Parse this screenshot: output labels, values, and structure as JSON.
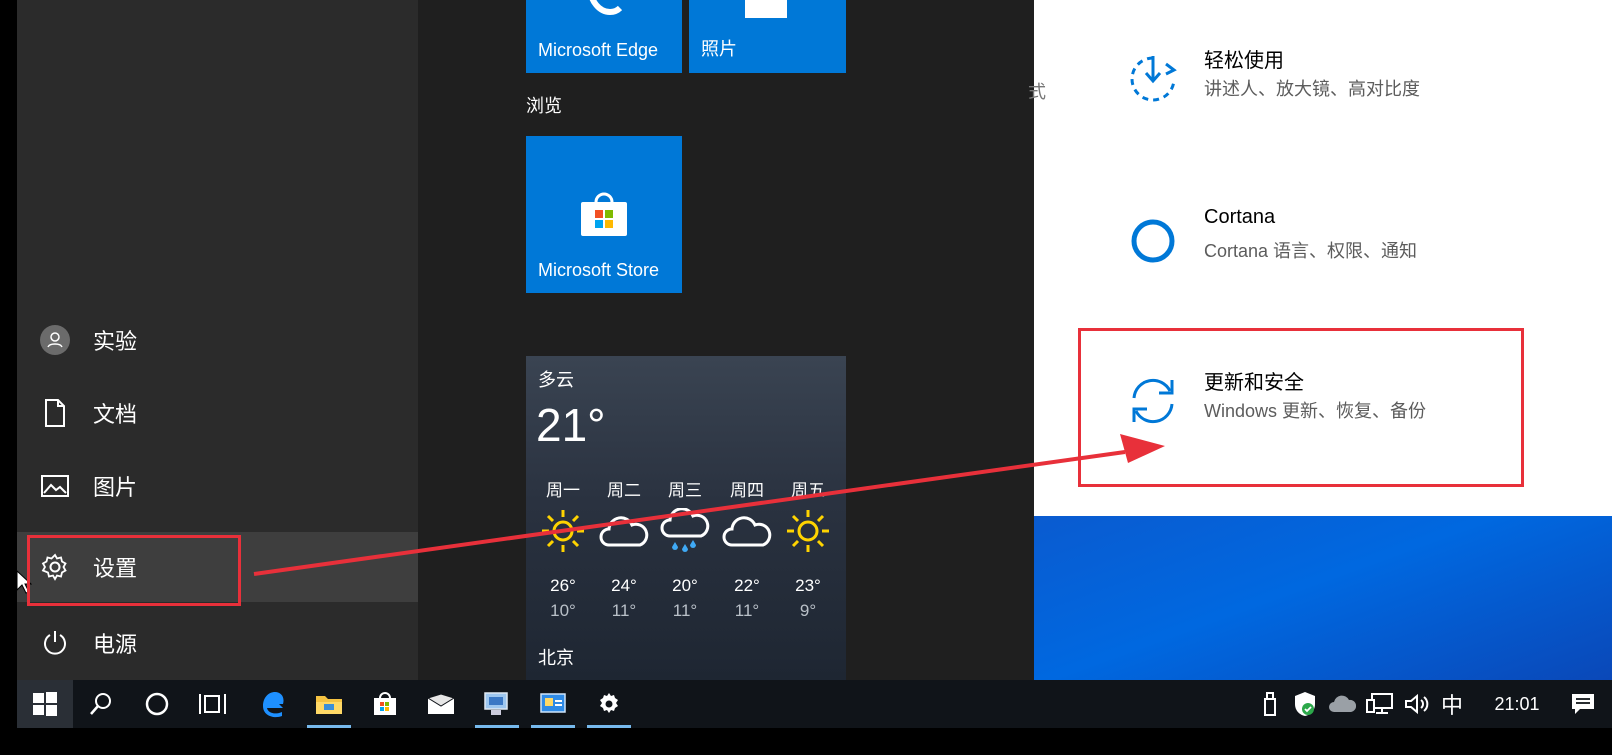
{
  "start_menu": {
    "user_label": "实验",
    "documents_label": "文档",
    "pictures_label": "图片",
    "settings_label": "设置",
    "power_label": "电源"
  },
  "tiles": {
    "edge_label": "Microsoft Edge",
    "photos_label": "照片",
    "browse_group_label": "浏览",
    "store_label": "Microsoft Store"
  },
  "weather": {
    "condition": "多云",
    "temperature": "21°",
    "city": "北京",
    "forecast": [
      {
        "day": "周一",
        "icon": "sunny-icon",
        "high": "26°",
        "low": "10°"
      },
      {
        "day": "周二",
        "icon": "cloudy-icon",
        "high": "24°",
        "low": "11°"
      },
      {
        "day": "周三",
        "icon": "rain-icon",
        "high": "20°",
        "low": "11°"
      },
      {
        "day": "周四",
        "icon": "cloudy-icon",
        "high": "22°",
        "low": "11°"
      },
      {
        "day": "周五",
        "icon": "sunny-icon",
        "high": "23°",
        "low": "9°"
      }
    ]
  },
  "settings_window": {
    "partial_text": "式",
    "items": [
      {
        "title": "轻松使用",
        "subtitle": "讲述人、放大镜、高对比度",
        "icon": "ease-of-access-icon"
      },
      {
        "title": "Cortana",
        "subtitle": "Cortana 语言、权限、通知",
        "icon": "cortana-icon"
      },
      {
        "title": "更新和安全",
        "subtitle": "Windows 更新、恢复、备份",
        "icon": "update-icon"
      }
    ]
  },
  "taskbar": {
    "ime_label": "中",
    "clock": "21:01"
  },
  "colors": {
    "accent": "#0078d7",
    "annotation_red": "#e8303a",
    "taskbar_bg": "#101419"
  }
}
